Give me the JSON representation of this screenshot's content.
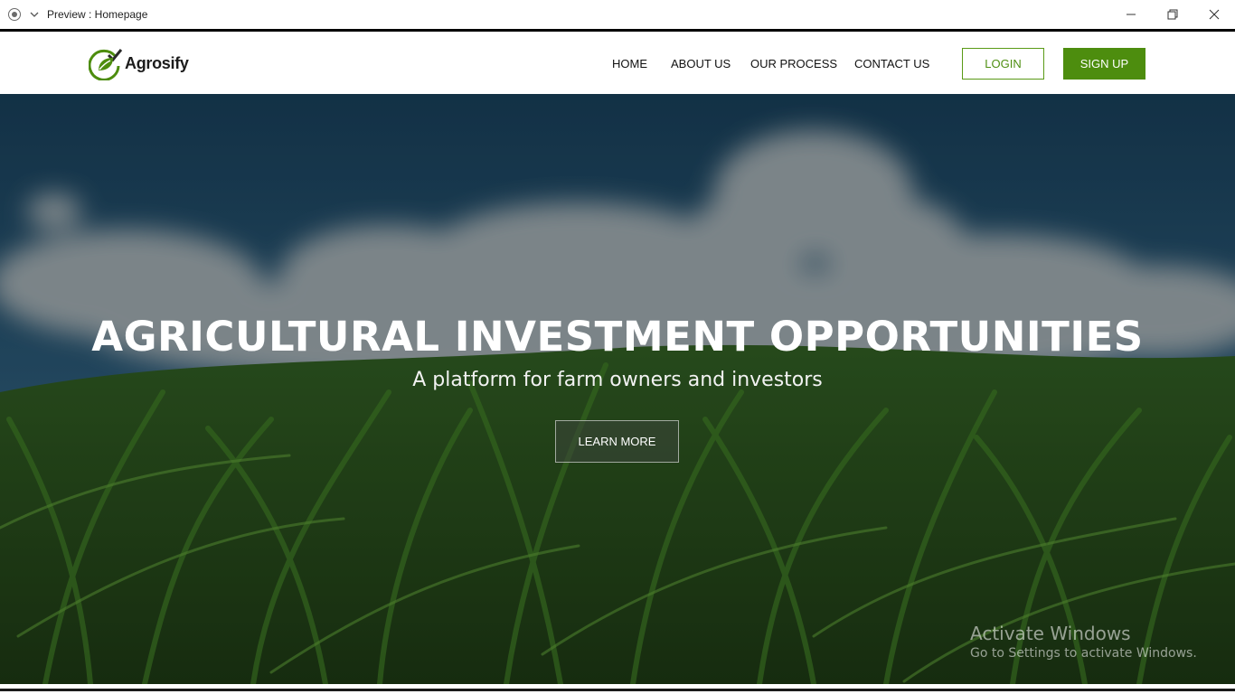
{
  "window": {
    "title": "Preview : Homepage",
    "record_icon": "record-icon",
    "menu_icon": "chevron-down-icon",
    "controls": [
      "minimize-icon",
      "restore-icon",
      "close-icon"
    ]
  },
  "header": {
    "logo_text": "Agrosify",
    "logo_icon": "leaf-check-icon",
    "nav": [
      {
        "label": "HOME"
      },
      {
        "label": "ABOUT US"
      },
      {
        "label": "OUR PROCESS"
      },
      {
        "label": "CONTACT US"
      }
    ],
    "login_label": "LOGIN",
    "signup_label": "SIGN UP"
  },
  "hero": {
    "title": "AGRICULTURAL INVESTMENT OPPORTUNITIES",
    "subtitle": "A platform for farm owners and investors",
    "cta_label": "LEARN MORE"
  },
  "watermark": {
    "title": "Activate Windows",
    "subtitle": "Go to Settings to activate Windows."
  },
  "colors": {
    "brand_green": "#4d8d0e",
    "sky": "#1f4a66",
    "field": "#25451a"
  }
}
